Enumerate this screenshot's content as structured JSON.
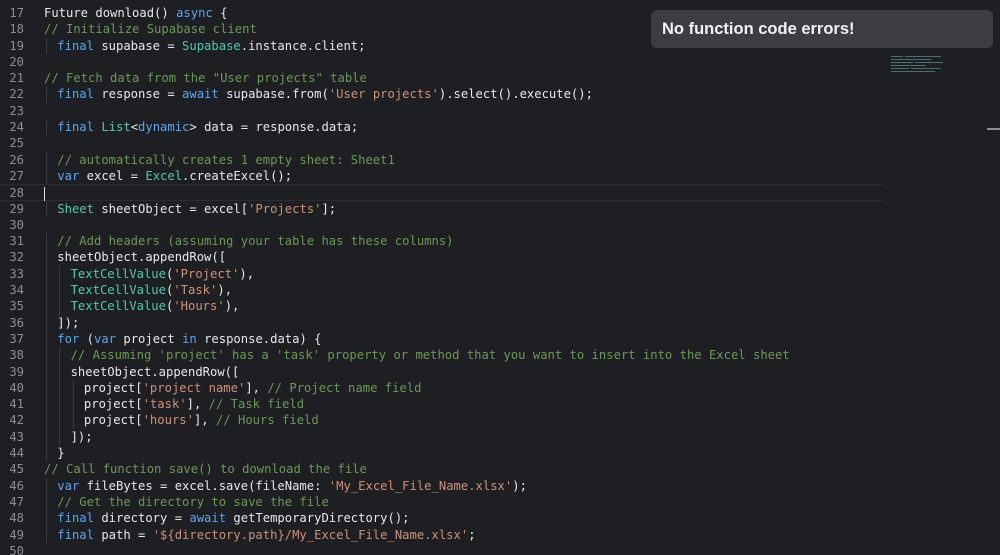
{
  "toast": {
    "message": "No function code errors!"
  },
  "editor": {
    "lines": [
      {
        "n": "17",
        "indent": 0,
        "tokens": [
          [
            "fn",
            "Future download() "
          ],
          [
            "kw",
            "async"
          ],
          [
            "fn",
            " {"
          ]
        ]
      },
      {
        "n": "18",
        "indent": 0,
        "tokens": [
          [
            "cm",
            "// Initialize Supabase client"
          ]
        ]
      },
      {
        "n": "19",
        "indent": 1,
        "tokens": [
          [
            "kw",
            "final"
          ],
          [
            "fn",
            " supabase = "
          ],
          [
            "ty",
            "Supabase"
          ],
          [
            "fn",
            ".instance.client;"
          ]
        ]
      },
      {
        "n": "20",
        "indent": 0,
        "tokens": []
      },
      {
        "n": "21",
        "indent": 0,
        "tokens": [
          [
            "cm",
            "// Fetch data from the \"User projects\" table"
          ]
        ]
      },
      {
        "n": "22",
        "indent": 1,
        "tokens": [
          [
            "kw",
            "final"
          ],
          [
            "fn",
            " response = "
          ],
          [
            "kw",
            "await"
          ],
          [
            "fn",
            " supabase.from("
          ],
          [
            "st",
            "'User projects'"
          ],
          [
            "fn",
            ").select().execute();"
          ]
        ]
      },
      {
        "n": "23",
        "indent": 0,
        "tokens": []
      },
      {
        "n": "24",
        "indent": 1,
        "tokens": [
          [
            "kw",
            "final"
          ],
          [
            "fn",
            " "
          ],
          [
            "ty",
            "List"
          ],
          [
            "fn",
            "<"
          ],
          [
            "kw",
            "dynamic"
          ],
          [
            "fn",
            "> data = response.data;"
          ]
        ]
      },
      {
        "n": "25",
        "indent": 0,
        "tokens": []
      },
      {
        "n": "26",
        "indent": 1,
        "tokens": [
          [
            "cm",
            "// automatically creates 1 empty sheet: Sheet1"
          ]
        ]
      },
      {
        "n": "27",
        "indent": 1,
        "tokens": [
          [
            "kw",
            "var"
          ],
          [
            "fn",
            " excel = "
          ],
          [
            "ty",
            "Excel"
          ],
          [
            "fn",
            ".createExcel();"
          ]
        ]
      },
      {
        "n": "28",
        "indent": 0,
        "tokens": [],
        "current": true
      },
      {
        "n": "29",
        "indent": 1,
        "tokens": [
          [
            "ty",
            "Sheet"
          ],
          [
            "fn",
            " sheetObject = excel["
          ],
          [
            "st",
            "'Projects'"
          ],
          [
            "fn",
            "];"
          ]
        ]
      },
      {
        "n": "30",
        "indent": 0,
        "tokens": []
      },
      {
        "n": "31",
        "indent": 1,
        "tokens": [
          [
            "cm",
            "// Add headers (assuming your table has these columns)"
          ]
        ]
      },
      {
        "n": "32",
        "indent": 1,
        "tokens": [
          [
            "fn",
            "sheetObject.appendRow(["
          ]
        ]
      },
      {
        "n": "33",
        "indent": 2,
        "tokens": [
          [
            "ty",
            "TextCellValue"
          ],
          [
            "fn",
            "("
          ],
          [
            "st",
            "'Project'"
          ],
          [
            "fn",
            "),"
          ]
        ]
      },
      {
        "n": "34",
        "indent": 2,
        "tokens": [
          [
            "ty",
            "TextCellValue"
          ],
          [
            "fn",
            "("
          ],
          [
            "st",
            "'Task'"
          ],
          [
            "fn",
            "),"
          ]
        ]
      },
      {
        "n": "35",
        "indent": 2,
        "tokens": [
          [
            "ty",
            "TextCellValue"
          ],
          [
            "fn",
            "("
          ],
          [
            "st",
            "'Hours'"
          ],
          [
            "fn",
            "),"
          ]
        ]
      },
      {
        "n": "36",
        "indent": 1,
        "tokens": [
          [
            "fn",
            "]);"
          ]
        ]
      },
      {
        "n": "37",
        "indent": 1,
        "tokens": [
          [
            "kw",
            "for"
          ],
          [
            "fn",
            " ("
          ],
          [
            "kw",
            "var"
          ],
          [
            "fn",
            " project "
          ],
          [
            "kw",
            "in"
          ],
          [
            "fn",
            " response.data) {"
          ]
        ]
      },
      {
        "n": "38",
        "indent": 2,
        "tokens": [
          [
            "cm",
            "// Assuming 'project' has a 'task' property or method that you want to insert into the Excel sheet"
          ]
        ]
      },
      {
        "n": "39",
        "indent": 2,
        "tokens": [
          [
            "fn",
            "sheetObject.appendRow(["
          ]
        ]
      },
      {
        "n": "40",
        "indent": 3,
        "tokens": [
          [
            "fn",
            "project["
          ],
          [
            "st",
            "'project name'"
          ],
          [
            "fn",
            "], "
          ],
          [
            "cm",
            "// Project name field"
          ]
        ]
      },
      {
        "n": "41",
        "indent": 3,
        "tokens": [
          [
            "fn",
            "project["
          ],
          [
            "st",
            "'task'"
          ],
          [
            "fn",
            "], "
          ],
          [
            "cm",
            "// Task field"
          ]
        ]
      },
      {
        "n": "42",
        "indent": 3,
        "tokens": [
          [
            "fn",
            "project["
          ],
          [
            "st",
            "'hours'"
          ],
          [
            "fn",
            "], "
          ],
          [
            "cm",
            "// Hours field"
          ]
        ]
      },
      {
        "n": "43",
        "indent": 2,
        "tokens": [
          [
            "fn",
            "]);"
          ]
        ]
      },
      {
        "n": "44",
        "indent": 1,
        "tokens": [
          [
            "fn",
            "}"
          ]
        ]
      },
      {
        "n": "45",
        "indent": 0,
        "tokens": [
          [
            "cm",
            "// Call function save() to download the file"
          ]
        ]
      },
      {
        "n": "46",
        "indent": 1,
        "tokens": [
          [
            "kw",
            "var"
          ],
          [
            "fn",
            " fileBytes = excel.save(fileName: "
          ],
          [
            "st",
            "'My_Excel_File_Name.xlsx'"
          ],
          [
            "fn",
            ");"
          ]
        ]
      },
      {
        "n": "47",
        "indent": 1,
        "tokens": [
          [
            "cm",
            "// Get the directory to save the file"
          ]
        ]
      },
      {
        "n": "48",
        "indent": 1,
        "tokens": [
          [
            "kw",
            "final"
          ],
          [
            "fn",
            " directory = "
          ],
          [
            "kw",
            "await"
          ],
          [
            "fn",
            " getTemporaryDirectory();"
          ]
        ]
      },
      {
        "n": "49",
        "indent": 1,
        "tokens": [
          [
            "kw",
            "final"
          ],
          [
            "fn",
            " path = "
          ],
          [
            "st",
            "'${directory.path}/My_Excel_File_Name.xlsx'"
          ],
          [
            "fn",
            ";"
          ]
        ]
      },
      {
        "n": "50",
        "indent": 0,
        "tokens": []
      }
    ]
  }
}
